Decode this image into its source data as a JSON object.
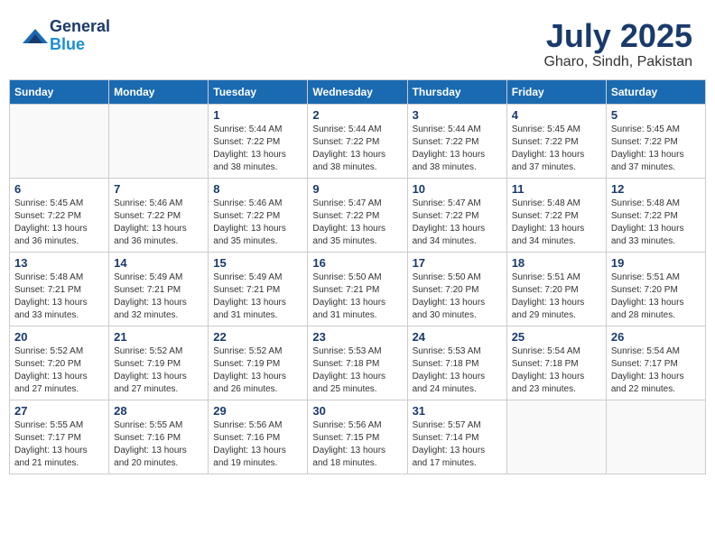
{
  "header": {
    "logo_line1": "General",
    "logo_line2": "Blue",
    "month_title": "July 2025",
    "location": "Gharo, Sindh, Pakistan"
  },
  "weekdays": [
    "Sunday",
    "Monday",
    "Tuesday",
    "Wednesday",
    "Thursday",
    "Friday",
    "Saturday"
  ],
  "weeks": [
    [
      {
        "day": "",
        "sunrise": "",
        "sunset": "",
        "daylight": ""
      },
      {
        "day": "",
        "sunrise": "",
        "sunset": "",
        "daylight": ""
      },
      {
        "day": "1",
        "sunrise": "Sunrise: 5:44 AM",
        "sunset": "Sunset: 7:22 PM",
        "daylight": "Daylight: 13 hours and 38 minutes."
      },
      {
        "day": "2",
        "sunrise": "Sunrise: 5:44 AM",
        "sunset": "Sunset: 7:22 PM",
        "daylight": "Daylight: 13 hours and 38 minutes."
      },
      {
        "day": "3",
        "sunrise": "Sunrise: 5:44 AM",
        "sunset": "Sunset: 7:22 PM",
        "daylight": "Daylight: 13 hours and 38 minutes."
      },
      {
        "day": "4",
        "sunrise": "Sunrise: 5:45 AM",
        "sunset": "Sunset: 7:22 PM",
        "daylight": "Daylight: 13 hours and 37 minutes."
      },
      {
        "day": "5",
        "sunrise": "Sunrise: 5:45 AM",
        "sunset": "Sunset: 7:22 PM",
        "daylight": "Daylight: 13 hours and 37 minutes."
      }
    ],
    [
      {
        "day": "6",
        "sunrise": "Sunrise: 5:45 AM",
        "sunset": "Sunset: 7:22 PM",
        "daylight": "Daylight: 13 hours and 36 minutes."
      },
      {
        "day": "7",
        "sunrise": "Sunrise: 5:46 AM",
        "sunset": "Sunset: 7:22 PM",
        "daylight": "Daylight: 13 hours and 36 minutes."
      },
      {
        "day": "8",
        "sunrise": "Sunrise: 5:46 AM",
        "sunset": "Sunset: 7:22 PM",
        "daylight": "Daylight: 13 hours and 35 minutes."
      },
      {
        "day": "9",
        "sunrise": "Sunrise: 5:47 AM",
        "sunset": "Sunset: 7:22 PM",
        "daylight": "Daylight: 13 hours and 35 minutes."
      },
      {
        "day": "10",
        "sunrise": "Sunrise: 5:47 AM",
        "sunset": "Sunset: 7:22 PM",
        "daylight": "Daylight: 13 hours and 34 minutes."
      },
      {
        "day": "11",
        "sunrise": "Sunrise: 5:48 AM",
        "sunset": "Sunset: 7:22 PM",
        "daylight": "Daylight: 13 hours and 34 minutes."
      },
      {
        "day": "12",
        "sunrise": "Sunrise: 5:48 AM",
        "sunset": "Sunset: 7:22 PM",
        "daylight": "Daylight: 13 hours and 33 minutes."
      }
    ],
    [
      {
        "day": "13",
        "sunrise": "Sunrise: 5:48 AM",
        "sunset": "Sunset: 7:21 PM",
        "daylight": "Daylight: 13 hours and 33 minutes."
      },
      {
        "day": "14",
        "sunrise": "Sunrise: 5:49 AM",
        "sunset": "Sunset: 7:21 PM",
        "daylight": "Daylight: 13 hours and 32 minutes."
      },
      {
        "day": "15",
        "sunrise": "Sunrise: 5:49 AM",
        "sunset": "Sunset: 7:21 PM",
        "daylight": "Daylight: 13 hours and 31 minutes."
      },
      {
        "day": "16",
        "sunrise": "Sunrise: 5:50 AM",
        "sunset": "Sunset: 7:21 PM",
        "daylight": "Daylight: 13 hours and 31 minutes."
      },
      {
        "day": "17",
        "sunrise": "Sunrise: 5:50 AM",
        "sunset": "Sunset: 7:20 PM",
        "daylight": "Daylight: 13 hours and 30 minutes."
      },
      {
        "day": "18",
        "sunrise": "Sunrise: 5:51 AM",
        "sunset": "Sunset: 7:20 PM",
        "daylight": "Daylight: 13 hours and 29 minutes."
      },
      {
        "day": "19",
        "sunrise": "Sunrise: 5:51 AM",
        "sunset": "Sunset: 7:20 PM",
        "daylight": "Daylight: 13 hours and 28 minutes."
      }
    ],
    [
      {
        "day": "20",
        "sunrise": "Sunrise: 5:52 AM",
        "sunset": "Sunset: 7:20 PM",
        "daylight": "Daylight: 13 hours and 27 minutes."
      },
      {
        "day": "21",
        "sunrise": "Sunrise: 5:52 AM",
        "sunset": "Sunset: 7:19 PM",
        "daylight": "Daylight: 13 hours and 27 minutes."
      },
      {
        "day": "22",
        "sunrise": "Sunrise: 5:52 AM",
        "sunset": "Sunset: 7:19 PM",
        "daylight": "Daylight: 13 hours and 26 minutes."
      },
      {
        "day": "23",
        "sunrise": "Sunrise: 5:53 AM",
        "sunset": "Sunset: 7:18 PM",
        "daylight": "Daylight: 13 hours and 25 minutes."
      },
      {
        "day": "24",
        "sunrise": "Sunrise: 5:53 AM",
        "sunset": "Sunset: 7:18 PM",
        "daylight": "Daylight: 13 hours and 24 minutes."
      },
      {
        "day": "25",
        "sunrise": "Sunrise: 5:54 AM",
        "sunset": "Sunset: 7:18 PM",
        "daylight": "Daylight: 13 hours and 23 minutes."
      },
      {
        "day": "26",
        "sunrise": "Sunrise: 5:54 AM",
        "sunset": "Sunset: 7:17 PM",
        "daylight": "Daylight: 13 hours and 22 minutes."
      }
    ],
    [
      {
        "day": "27",
        "sunrise": "Sunrise: 5:55 AM",
        "sunset": "Sunset: 7:17 PM",
        "daylight": "Daylight: 13 hours and 21 minutes."
      },
      {
        "day": "28",
        "sunrise": "Sunrise: 5:55 AM",
        "sunset": "Sunset: 7:16 PM",
        "daylight": "Daylight: 13 hours and 20 minutes."
      },
      {
        "day": "29",
        "sunrise": "Sunrise: 5:56 AM",
        "sunset": "Sunset: 7:16 PM",
        "daylight": "Daylight: 13 hours and 19 minutes."
      },
      {
        "day": "30",
        "sunrise": "Sunrise: 5:56 AM",
        "sunset": "Sunset: 7:15 PM",
        "daylight": "Daylight: 13 hours and 18 minutes."
      },
      {
        "day": "31",
        "sunrise": "Sunrise: 5:57 AM",
        "sunset": "Sunset: 7:14 PM",
        "daylight": "Daylight: 13 hours and 17 minutes."
      },
      {
        "day": "",
        "sunrise": "",
        "sunset": "",
        "daylight": ""
      },
      {
        "day": "",
        "sunrise": "",
        "sunset": "",
        "daylight": ""
      }
    ]
  ]
}
